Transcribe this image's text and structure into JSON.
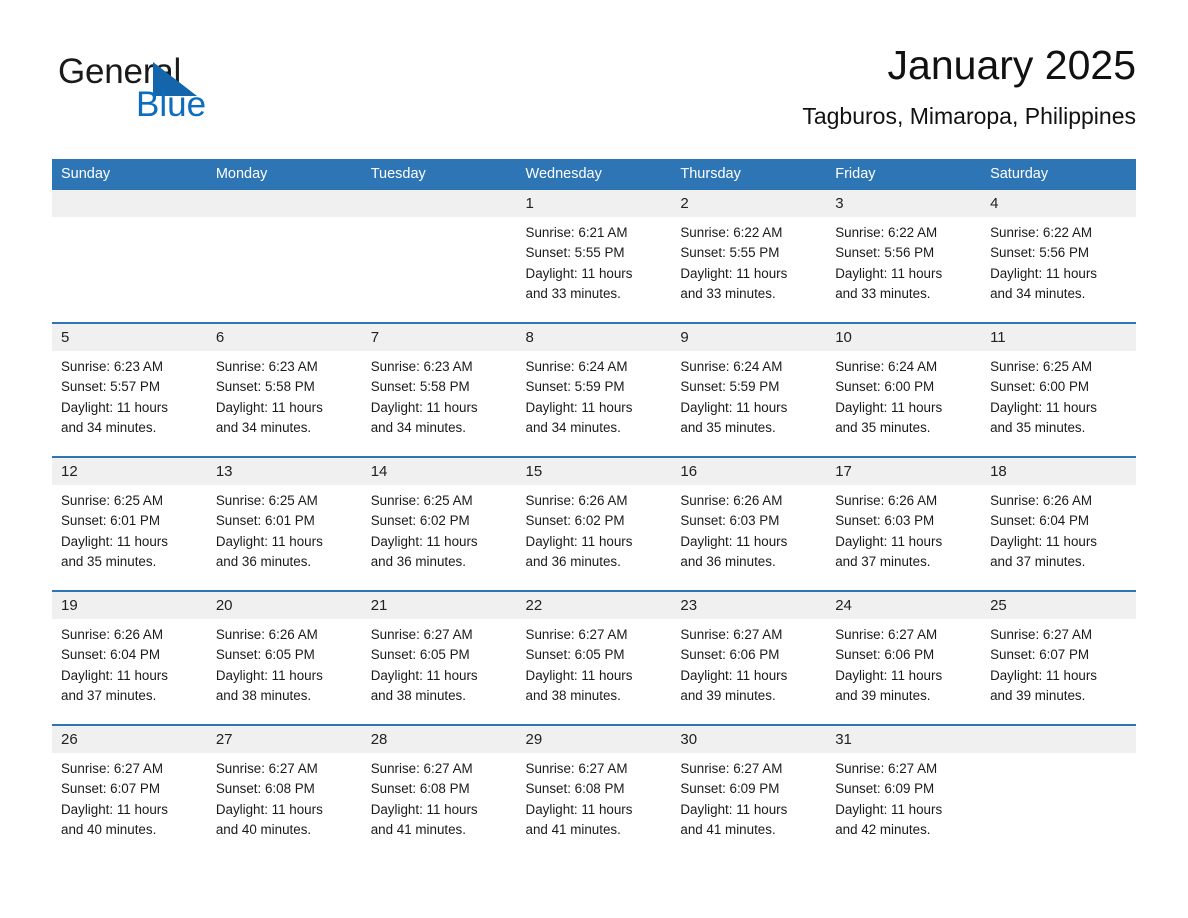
{
  "brand": {
    "name_part1": "General",
    "name_part2": "Blue",
    "triangle_color": "#1565ad",
    "blue_color": "#0b6cc0"
  },
  "header": {
    "title": "January 2025",
    "subtitle": "Tagburos, Mimaropa, Philippines"
  },
  "theme": {
    "header_blue": "#2e75b6",
    "daynum_band": "#f0f0f0",
    "text": "#1a1a1a"
  },
  "calendar": {
    "weekday_headers": [
      "Sunday",
      "Monday",
      "Tuesday",
      "Wednesday",
      "Thursday",
      "Friday",
      "Saturday"
    ],
    "weeks": [
      [
        {
          "day": "",
          "sunrise": "",
          "sunset": "",
          "daylight_line1": "",
          "daylight_line2": "",
          "empty": true
        },
        {
          "day": "",
          "sunrise": "",
          "sunset": "",
          "daylight_line1": "",
          "daylight_line2": "",
          "empty": true
        },
        {
          "day": "",
          "sunrise": "",
          "sunset": "",
          "daylight_line1": "",
          "daylight_line2": "",
          "empty": true
        },
        {
          "day": "1",
          "sunrise": "Sunrise: 6:21 AM",
          "sunset": "Sunset: 5:55 PM",
          "daylight_line1": "Daylight: 11 hours",
          "daylight_line2": "and 33 minutes.",
          "empty": false
        },
        {
          "day": "2",
          "sunrise": "Sunrise: 6:22 AM",
          "sunset": "Sunset: 5:55 PM",
          "daylight_line1": "Daylight: 11 hours",
          "daylight_line2": "and 33 minutes.",
          "empty": false
        },
        {
          "day": "3",
          "sunrise": "Sunrise: 6:22 AM",
          "sunset": "Sunset: 5:56 PM",
          "daylight_line1": "Daylight: 11 hours",
          "daylight_line2": "and 33 minutes.",
          "empty": false
        },
        {
          "day": "4",
          "sunrise": "Sunrise: 6:22 AM",
          "sunset": "Sunset: 5:56 PM",
          "daylight_line1": "Daylight: 11 hours",
          "daylight_line2": "and 34 minutes.",
          "empty": false
        }
      ],
      [
        {
          "day": "5",
          "sunrise": "Sunrise: 6:23 AM",
          "sunset": "Sunset: 5:57 PM",
          "daylight_line1": "Daylight: 11 hours",
          "daylight_line2": "and 34 minutes.",
          "empty": false
        },
        {
          "day": "6",
          "sunrise": "Sunrise: 6:23 AM",
          "sunset": "Sunset: 5:58 PM",
          "daylight_line1": "Daylight: 11 hours",
          "daylight_line2": "and 34 minutes.",
          "empty": false
        },
        {
          "day": "7",
          "sunrise": "Sunrise: 6:23 AM",
          "sunset": "Sunset: 5:58 PM",
          "daylight_line1": "Daylight: 11 hours",
          "daylight_line2": "and 34 minutes.",
          "empty": false
        },
        {
          "day": "8",
          "sunrise": "Sunrise: 6:24 AM",
          "sunset": "Sunset: 5:59 PM",
          "daylight_line1": "Daylight: 11 hours",
          "daylight_line2": "and 34 minutes.",
          "empty": false
        },
        {
          "day": "9",
          "sunrise": "Sunrise: 6:24 AM",
          "sunset": "Sunset: 5:59 PM",
          "daylight_line1": "Daylight: 11 hours",
          "daylight_line2": "and 35 minutes.",
          "empty": false
        },
        {
          "day": "10",
          "sunrise": "Sunrise: 6:24 AM",
          "sunset": "Sunset: 6:00 PM",
          "daylight_line1": "Daylight: 11 hours",
          "daylight_line2": "and 35 minutes.",
          "empty": false
        },
        {
          "day": "11",
          "sunrise": "Sunrise: 6:25 AM",
          "sunset": "Sunset: 6:00 PM",
          "daylight_line1": "Daylight: 11 hours",
          "daylight_line2": "and 35 minutes.",
          "empty": false
        }
      ],
      [
        {
          "day": "12",
          "sunrise": "Sunrise: 6:25 AM",
          "sunset": "Sunset: 6:01 PM",
          "daylight_line1": "Daylight: 11 hours",
          "daylight_line2": "and 35 minutes.",
          "empty": false
        },
        {
          "day": "13",
          "sunrise": "Sunrise: 6:25 AM",
          "sunset": "Sunset: 6:01 PM",
          "daylight_line1": "Daylight: 11 hours",
          "daylight_line2": "and 36 minutes.",
          "empty": false
        },
        {
          "day": "14",
          "sunrise": "Sunrise: 6:25 AM",
          "sunset": "Sunset: 6:02 PM",
          "daylight_line1": "Daylight: 11 hours",
          "daylight_line2": "and 36 minutes.",
          "empty": false
        },
        {
          "day": "15",
          "sunrise": "Sunrise: 6:26 AM",
          "sunset": "Sunset: 6:02 PM",
          "daylight_line1": "Daylight: 11 hours",
          "daylight_line2": "and 36 minutes.",
          "empty": false
        },
        {
          "day": "16",
          "sunrise": "Sunrise: 6:26 AM",
          "sunset": "Sunset: 6:03 PM",
          "daylight_line1": "Daylight: 11 hours",
          "daylight_line2": "and 36 minutes.",
          "empty": false
        },
        {
          "day": "17",
          "sunrise": "Sunrise: 6:26 AM",
          "sunset": "Sunset: 6:03 PM",
          "daylight_line1": "Daylight: 11 hours",
          "daylight_line2": "and 37 minutes.",
          "empty": false
        },
        {
          "day": "18",
          "sunrise": "Sunrise: 6:26 AM",
          "sunset": "Sunset: 6:04 PM",
          "daylight_line1": "Daylight: 11 hours",
          "daylight_line2": "and 37 minutes.",
          "empty": false
        }
      ],
      [
        {
          "day": "19",
          "sunrise": "Sunrise: 6:26 AM",
          "sunset": "Sunset: 6:04 PM",
          "daylight_line1": "Daylight: 11 hours",
          "daylight_line2": "and 37 minutes.",
          "empty": false
        },
        {
          "day": "20",
          "sunrise": "Sunrise: 6:26 AM",
          "sunset": "Sunset: 6:05 PM",
          "daylight_line1": "Daylight: 11 hours",
          "daylight_line2": "and 38 minutes.",
          "empty": false
        },
        {
          "day": "21",
          "sunrise": "Sunrise: 6:27 AM",
          "sunset": "Sunset: 6:05 PM",
          "daylight_line1": "Daylight: 11 hours",
          "daylight_line2": "and 38 minutes.",
          "empty": false
        },
        {
          "day": "22",
          "sunrise": "Sunrise: 6:27 AM",
          "sunset": "Sunset: 6:05 PM",
          "daylight_line1": "Daylight: 11 hours",
          "daylight_line2": "and 38 minutes.",
          "empty": false
        },
        {
          "day": "23",
          "sunrise": "Sunrise: 6:27 AM",
          "sunset": "Sunset: 6:06 PM",
          "daylight_line1": "Daylight: 11 hours",
          "daylight_line2": "and 39 minutes.",
          "empty": false
        },
        {
          "day": "24",
          "sunrise": "Sunrise: 6:27 AM",
          "sunset": "Sunset: 6:06 PM",
          "daylight_line1": "Daylight: 11 hours",
          "daylight_line2": "and 39 minutes.",
          "empty": false
        },
        {
          "day": "25",
          "sunrise": "Sunrise: 6:27 AM",
          "sunset": "Sunset: 6:07 PM",
          "daylight_line1": "Daylight: 11 hours",
          "daylight_line2": "and 39 minutes.",
          "empty": false
        }
      ],
      [
        {
          "day": "26",
          "sunrise": "Sunrise: 6:27 AM",
          "sunset": "Sunset: 6:07 PM",
          "daylight_line1": "Daylight: 11 hours",
          "daylight_line2": "and 40 minutes.",
          "empty": false
        },
        {
          "day": "27",
          "sunrise": "Sunrise: 6:27 AM",
          "sunset": "Sunset: 6:08 PM",
          "daylight_line1": "Daylight: 11 hours",
          "daylight_line2": "and 40 minutes.",
          "empty": false
        },
        {
          "day": "28",
          "sunrise": "Sunrise: 6:27 AM",
          "sunset": "Sunset: 6:08 PM",
          "daylight_line1": "Daylight: 11 hours",
          "daylight_line2": "and 41 minutes.",
          "empty": false
        },
        {
          "day": "29",
          "sunrise": "Sunrise: 6:27 AM",
          "sunset": "Sunset: 6:08 PM",
          "daylight_line1": "Daylight: 11 hours",
          "daylight_line2": "and 41 minutes.",
          "empty": false
        },
        {
          "day": "30",
          "sunrise": "Sunrise: 6:27 AM",
          "sunset": "Sunset: 6:09 PM",
          "daylight_line1": "Daylight: 11 hours",
          "daylight_line2": "and 41 minutes.",
          "empty": false
        },
        {
          "day": "31",
          "sunrise": "Sunrise: 6:27 AM",
          "sunset": "Sunset: 6:09 PM",
          "daylight_line1": "Daylight: 11 hours",
          "daylight_line2": "and 42 minutes.",
          "empty": false
        },
        {
          "day": "",
          "sunrise": "",
          "sunset": "",
          "daylight_line1": "",
          "daylight_line2": "",
          "empty": true
        }
      ]
    ]
  }
}
